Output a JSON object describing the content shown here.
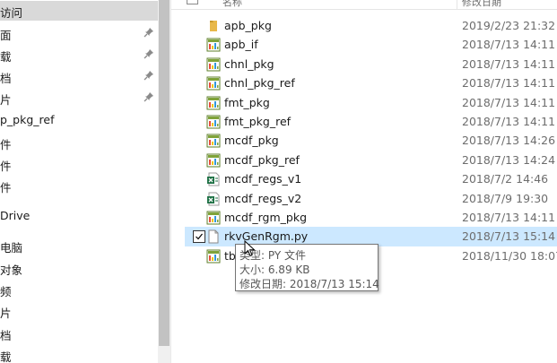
{
  "nav": {
    "items": [
      {
        "label": "访问",
        "pinned": false,
        "selected": true
      },
      {
        "label": "面",
        "pinned": true,
        "selected": false
      },
      {
        "label": "载",
        "pinned": true,
        "selected": false
      },
      {
        "label": "档",
        "pinned": true,
        "selected": false
      },
      {
        "label": "片",
        "pinned": true,
        "selected": false
      },
      {
        "label": "p_pkg_ref",
        "pinned": false,
        "selected": false
      },
      {
        "label": "件",
        "pinned": false,
        "selected": false
      },
      {
        "label": "件",
        "pinned": false,
        "selected": false
      },
      {
        "label": "件",
        "pinned": false,
        "selected": false
      },
      {
        "label": "",
        "pinned": false,
        "selected": false
      },
      {
        "label": "Drive",
        "pinned": false,
        "selected": false
      },
      {
        "label": "",
        "pinned": false,
        "selected": false
      },
      {
        "label": "电脑",
        "pinned": false,
        "selected": false
      },
      {
        "label": "对象",
        "pinned": false,
        "selected": false
      },
      {
        "label": "频",
        "pinned": false,
        "selected": false
      },
      {
        "label": "片",
        "pinned": false,
        "selected": false
      },
      {
        "label": "档",
        "pinned": false,
        "selected": false
      },
      {
        "label": "载",
        "pinned": false,
        "selected": false
      }
    ]
  },
  "header": {
    "name_label": "名称",
    "date_label": "修改日期"
  },
  "files": [
    {
      "name": "apb_pkg",
      "date": "2019/2/23 21:32",
      "icon": "folder-icon",
      "selected": false
    },
    {
      "name": "apb_if",
      "date": "2018/7/13 14:11",
      "icon": "script-file-icon",
      "selected": false
    },
    {
      "name": "chnl_pkg",
      "date": "2018/7/13 14:11",
      "icon": "script-file-icon",
      "selected": false
    },
    {
      "name": "chnl_pkg_ref",
      "date": "2018/7/13 14:11",
      "icon": "script-file-icon",
      "selected": false
    },
    {
      "name": "fmt_pkg",
      "date": "2018/7/13 14:11",
      "icon": "script-file-icon",
      "selected": false
    },
    {
      "name": "fmt_pkg_ref",
      "date": "2018/7/13 14:11",
      "icon": "script-file-icon",
      "selected": false
    },
    {
      "name": "mcdf_pkg",
      "date": "2018/7/13 14:26",
      "icon": "script-file-icon",
      "selected": false
    },
    {
      "name": "mcdf_pkg_ref",
      "date": "2018/7/13 14:24",
      "icon": "script-file-icon",
      "selected": false
    },
    {
      "name": "mcdf_regs_v1",
      "date": "2018/7/2 14:46",
      "icon": "excel-file-icon",
      "selected": false
    },
    {
      "name": "mcdf_regs_v2",
      "date": "2018/7/9 19:30",
      "icon": "excel-file-icon",
      "selected": false
    },
    {
      "name": "mcdf_rgm_pkg",
      "date": "2018/7/13 14:11",
      "icon": "script-file-icon",
      "selected": false
    },
    {
      "name": "rkvGenRgm.py",
      "date": "2018/7/13 15:14",
      "icon": "blank-file-icon",
      "selected": true
    },
    {
      "name": "tb",
      "date": "2018/11/30 18:07",
      "icon": "script-file-icon",
      "selected": false
    }
  ],
  "tooltip": {
    "type_line": "类型: PY 文件",
    "size_line": "大小: 6.89 KB",
    "date_line": "修改日期: 2018/7/13 15:14"
  },
  "colors": {
    "selected_row": "#cce8ff",
    "selected_nav": "#d9d9d9",
    "folder": "#e8b84a",
    "excel": "#1e7145"
  }
}
